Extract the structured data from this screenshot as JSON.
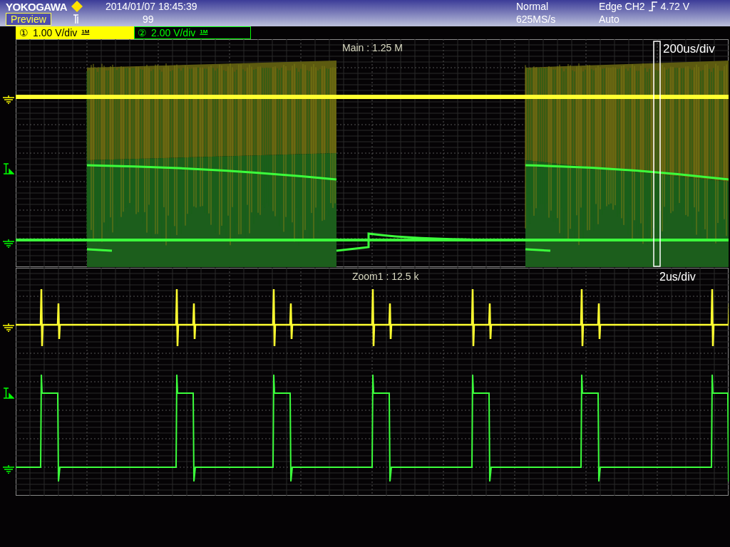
{
  "header": {
    "brand": "YOKOGAWA",
    "mode_button": "Preview",
    "datetime": "2014/01/07 18:45:39",
    "count": "99",
    "acq_mode": "Normal",
    "sample_rate": "625MS/s",
    "trigger_source": "Edge CH2",
    "trigger_level": "4.72 V",
    "trigger_mode": "Auto"
  },
  "channels": [
    {
      "number": "①",
      "scale": "1.00 V/div",
      "impedance": "1M",
      "color": "#ffff00",
      "selected": true
    },
    {
      "number": "②",
      "scale": "2.00 V/div",
      "impedance": "1M",
      "color": "#00ff00",
      "selected": false
    }
  ],
  "windows": [
    {
      "kind": "main",
      "label": "Main : 1.25 M",
      "timebase": "200us/div"
    },
    {
      "kind": "zoom",
      "label": "Zoom1 : 12.5 k",
      "timebase": "2us/div"
    }
  ]
}
